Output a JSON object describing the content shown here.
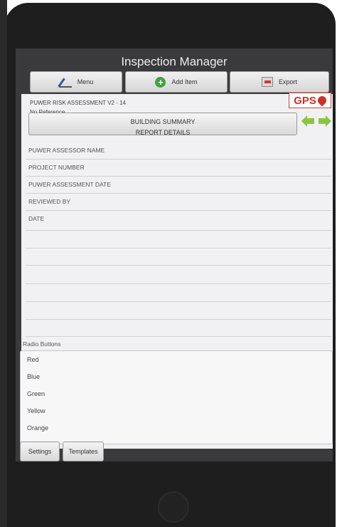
{
  "app": {
    "title": "Inspection Manager"
  },
  "toolbar": {
    "menu_label": "Menu",
    "add_label": "Add Item",
    "export_label": "Export"
  },
  "report": {
    "title": "PUWER RISK ASSESSMENT V2 - 14",
    "reference": "No Reference",
    "gps_label": "GPS",
    "summary_line1": "BUILDING SUMMARY",
    "summary_line2": "REPORT DETAILS"
  },
  "fields": {
    "assessor": "PUWER ASSESSOR NAME",
    "project": "PROJECT NUMBER",
    "date_assessment": "PUWER ASSESSMENT DATE",
    "reviewed": "REVIEWED BY",
    "date": "DATE"
  },
  "radio": {
    "label": "Radio Buttons",
    "options": [
      "Red",
      "Blue",
      "Green",
      "Yellow",
      "Orange"
    ]
  },
  "bottom": {
    "settings_label": "Settings",
    "templates_label": "Templates"
  },
  "colors": {
    "gps": "#d03025",
    "arrow_green": "#8cc63f",
    "add_icon": "#3fa33b"
  },
  "icons": [
    "pen-icon",
    "add-circle-icon",
    "export-icon",
    "gps-pin-icon",
    "arrow-left-icon",
    "arrow-right-icon"
  ]
}
